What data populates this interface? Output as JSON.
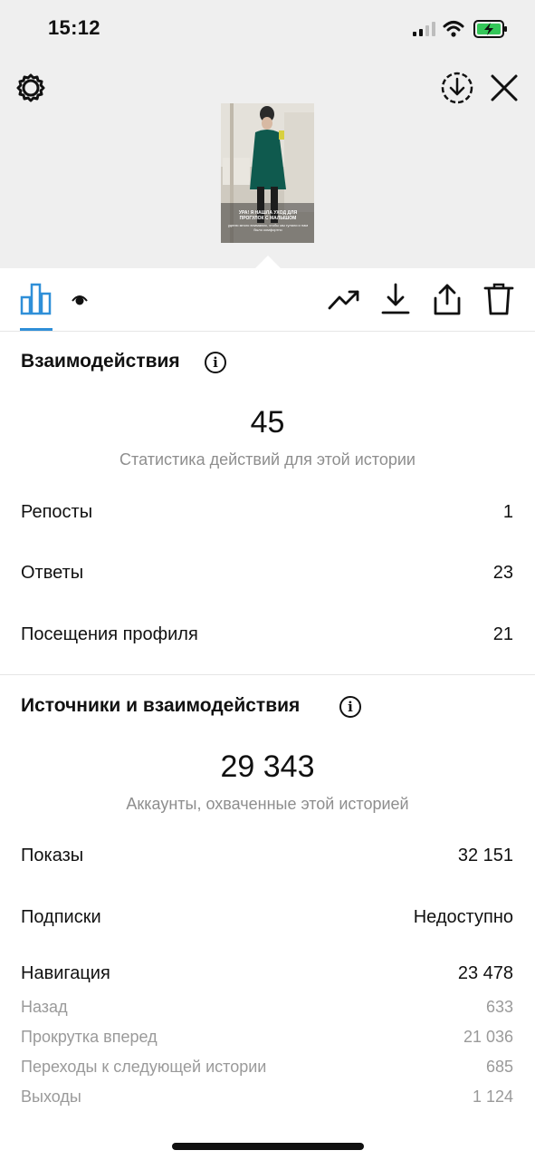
{
  "status_bar": {
    "time": "15:12"
  },
  "top_bar": {
    "settings_icon": "gear-icon",
    "save_icon": "download-circle-icon",
    "close_icon": "close-icon"
  },
  "story_thumbnail": {
    "caption_line1": "УРА! Я НАШЛА УХОД ДЛЯ",
    "caption_line2": "ПРОГУЛОК С МАЛЫШОМ",
    "caption_line3": "уделю много внимания, чтобы мы гуляли и нам было комфортно"
  },
  "toolbar": {
    "tabs": [
      {
        "icon": "bar-chart-icon",
        "selected": true
      },
      {
        "icon": "eye-icon",
        "selected": false
      }
    ],
    "actions": [
      {
        "icon": "trending-up-icon"
      },
      {
        "icon": "download-icon"
      },
      {
        "icon": "share-icon"
      },
      {
        "icon": "trash-icon"
      }
    ],
    "accent": "#2f8fd8"
  },
  "interactions": {
    "title": "Взаимодействия",
    "total": "45",
    "total_caption": "Статистика действий для этой истории",
    "rows": [
      {
        "label": "Репосты",
        "value": "1"
      },
      {
        "label": "Ответы",
        "value": "23"
      },
      {
        "label": "Посещения профиля",
        "value": "21"
      }
    ]
  },
  "discovery": {
    "title": "Источники и взаимодействия",
    "total": "29 343",
    "total_caption": "Аккаунты, охваченные этой историей",
    "rows": [
      {
        "label": "Показы",
        "value": "32 151"
      },
      {
        "label": "Подписки",
        "value": "Недоступно"
      },
      {
        "label": "Навигация",
        "value": "23 478"
      }
    ],
    "navigation_details": [
      {
        "label": "Назад",
        "value": "633"
      },
      {
        "label": "Прокрутка вперед",
        "value": "21 036"
      },
      {
        "label": "Переходы к следующей истории",
        "value": "685"
      },
      {
        "label": "Выходы",
        "value": "1 124"
      }
    ]
  }
}
